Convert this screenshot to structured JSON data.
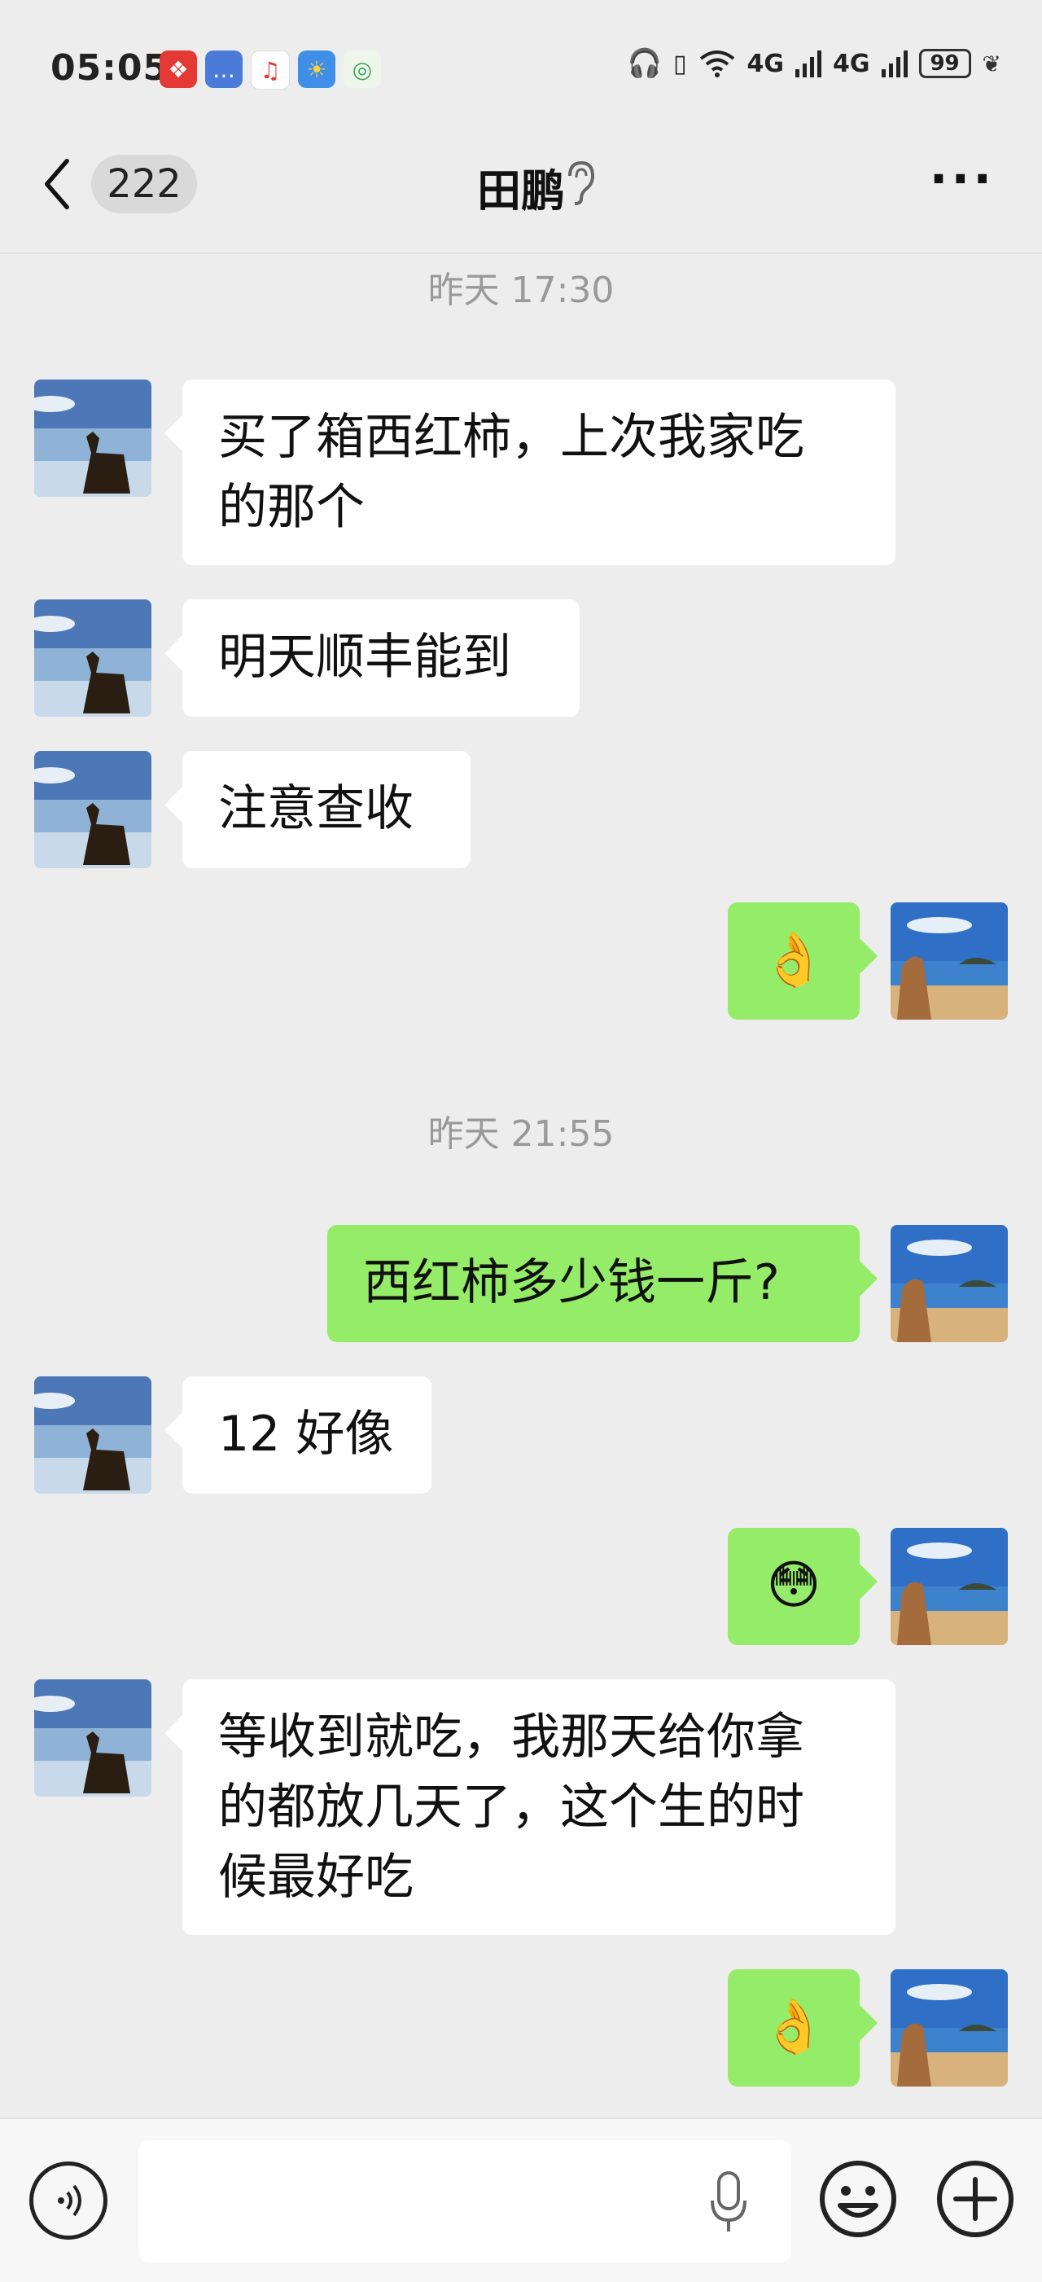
{
  "status_bar": {
    "time": "05:05",
    "apps": [
      "app-red-icon",
      "message-icon",
      "music-icon",
      "weather-icon",
      "app-green-icon"
    ],
    "signal1": "4G",
    "signal2": "4G",
    "battery": "99"
  },
  "nav": {
    "unread_count": "222",
    "title": "田鹏"
  },
  "messages": [
    {
      "type": "timestamp",
      "text": "昨天 17:30"
    },
    {
      "type": "text",
      "side": "left",
      "lines": [
        "买了箱西红柿，上次我家吃",
        "的那个"
      ]
    },
    {
      "type": "text",
      "side": "left",
      "text": "明天顺丰能到"
    },
    {
      "type": "text",
      "side": "left",
      "text": "注意查收"
    },
    {
      "type": "emoji",
      "side": "right",
      "emoji": "👌"
    },
    {
      "type": "timestamp",
      "text": "昨天 21:55"
    },
    {
      "type": "text",
      "side": "right",
      "text": "西红柿多少钱一斤?"
    },
    {
      "type": "text",
      "side": "left",
      "text": "12 好像"
    },
    {
      "type": "emoji",
      "side": "right",
      "emoji": "😳"
    },
    {
      "type": "text",
      "side": "left",
      "lines": [
        "等收到就吃，我那天给你拿",
        "的都放几天了，这个生的时",
        "候最好吃"
      ]
    },
    {
      "type": "emoji",
      "side": "right",
      "emoji": "👌"
    }
  ],
  "input": {
    "placeholder": ""
  },
  "colors": {
    "background": "#ededed",
    "left_bubble": "#ffffff",
    "right_bubble": "#95ec69"
  }
}
